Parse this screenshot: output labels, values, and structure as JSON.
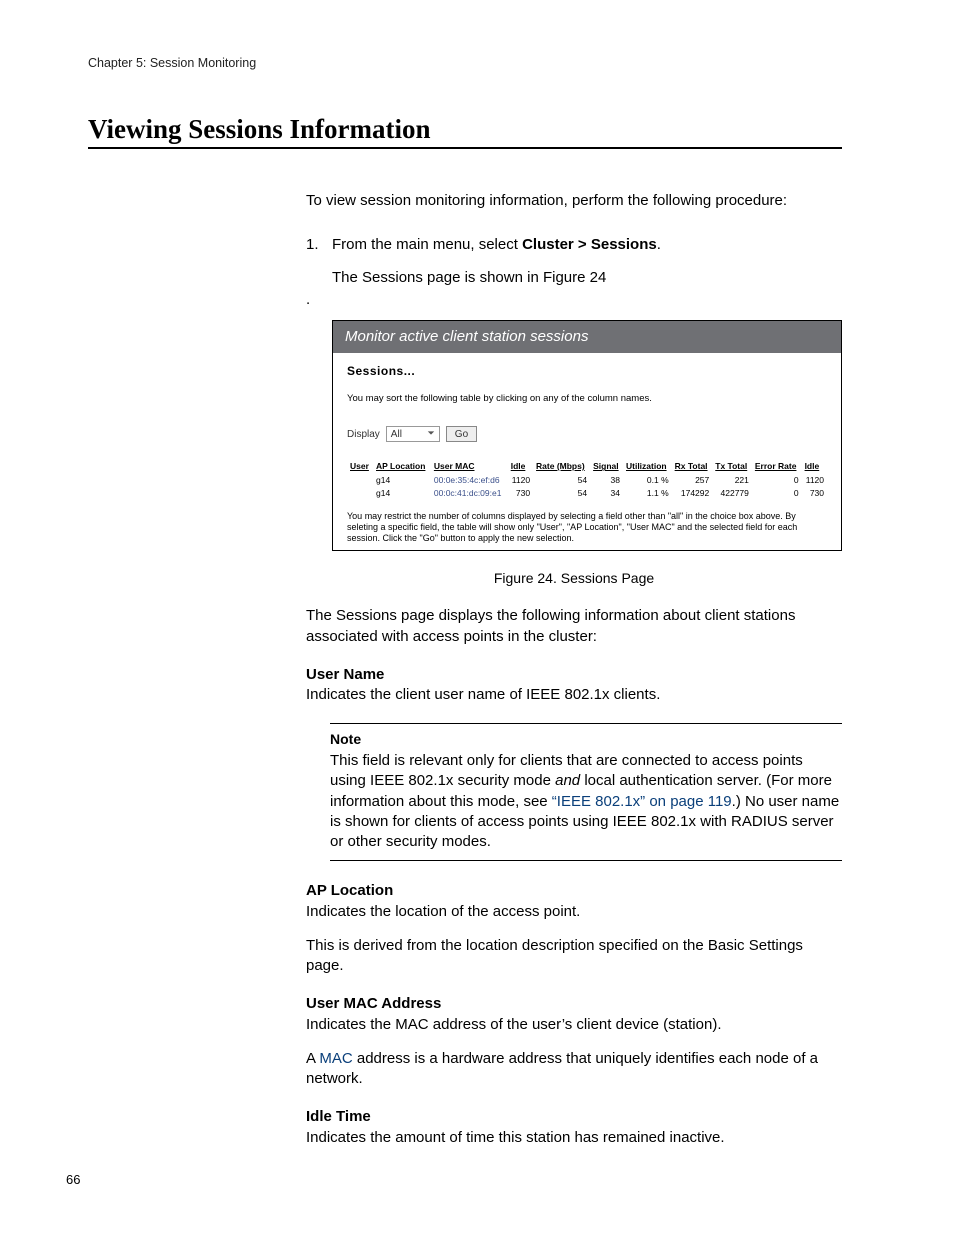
{
  "header": {
    "chapter": "Chapter 5: Session Monitoring"
  },
  "section": {
    "title": "Viewing Sessions Information"
  },
  "intro": "To view session monitoring information, perform the following procedure:",
  "step1": {
    "num": "1.",
    "pre": "From the main menu, select ",
    "bold": "Cluster > Sessions",
    "post": "."
  },
  "step1_result": "The Sessions page is shown in Figure 24",
  "dot": ".",
  "shot": {
    "title": "Monitor active client station sessions",
    "sessions_label": "Sessions...",
    "hint": "You may sort the following table by clicking on any of the column names.",
    "display_label": "Display",
    "select_value": "All",
    "go_label": "Go",
    "cols": [
      "User",
      "AP Location",
      "User MAC",
      "Idle",
      "Rate (Mbps)",
      "Signal",
      "Utilization",
      "Rx Total",
      "Tx Total",
      "Error Rate",
      "Idle"
    ],
    "rows": [
      {
        "user": "",
        "ap": "g14",
        "mac": "00:0e:35:4c:ef:d6",
        "idle": "1120",
        "rate": "54",
        "signal": "38",
        "util": "0.1 %",
        "rx": "257",
        "tx": "221",
        "err": "0",
        "idle2": "1120"
      },
      {
        "user": "",
        "ap": "g14",
        "mac": "00:0c:41:dc:09:e1",
        "idle": "730",
        "rate": "54",
        "signal": "34",
        "util": "1.1 %",
        "rx": "174292",
        "tx": "422779",
        "err": "0",
        "idle2": "730"
      }
    ],
    "footnote": "You may restrict the number of columns displayed by selecting a field other than \"all\" in the choice box above. By seleting a specific field, the table will show only \"User\", \"AP Location\", \"User MAC\" and the selected field for each session.  Click the \"Go\" button to apply the new selection."
  },
  "caption": "Figure 24. Sessions Page",
  "after_caption": "The Sessions page displays the following information about client stations associated with access points in the cluster:",
  "f1": {
    "term": "User Name",
    "desc": "Indicates the client user name of IEEE 802.1x clients."
  },
  "note": {
    "label": "Note",
    "p1a": "This field is relevant only for clients that are connected to access points using IEEE 802.1x security mode ",
    "p1b_italic": "and",
    "p1c": " local authentication server. (For more information about this mode, see ",
    "ref": "“IEEE 802.1x” on page 119",
    "p1d": ".) No user name is shown for clients of access points using IEEE 802.1x with RADIUS server or other security modes."
  },
  "f2": {
    "term": "AP Location",
    "desc": "Indicates the location of the access point.",
    "desc2": "This is derived from the location description specified on the Basic Settings page."
  },
  "f3": {
    "term": "User MAC Address",
    "desc": "Indicates the MAC address of the user’s client device (station).",
    "desc2a": "A ",
    "desc2_link": "MAC",
    "desc2b": " address is a hardware address that uniquely identifies each node of a network."
  },
  "f4": {
    "term": "Idle Time",
    "desc": "Indicates the amount of time this station has remained inactive."
  },
  "pagenum": "66"
}
